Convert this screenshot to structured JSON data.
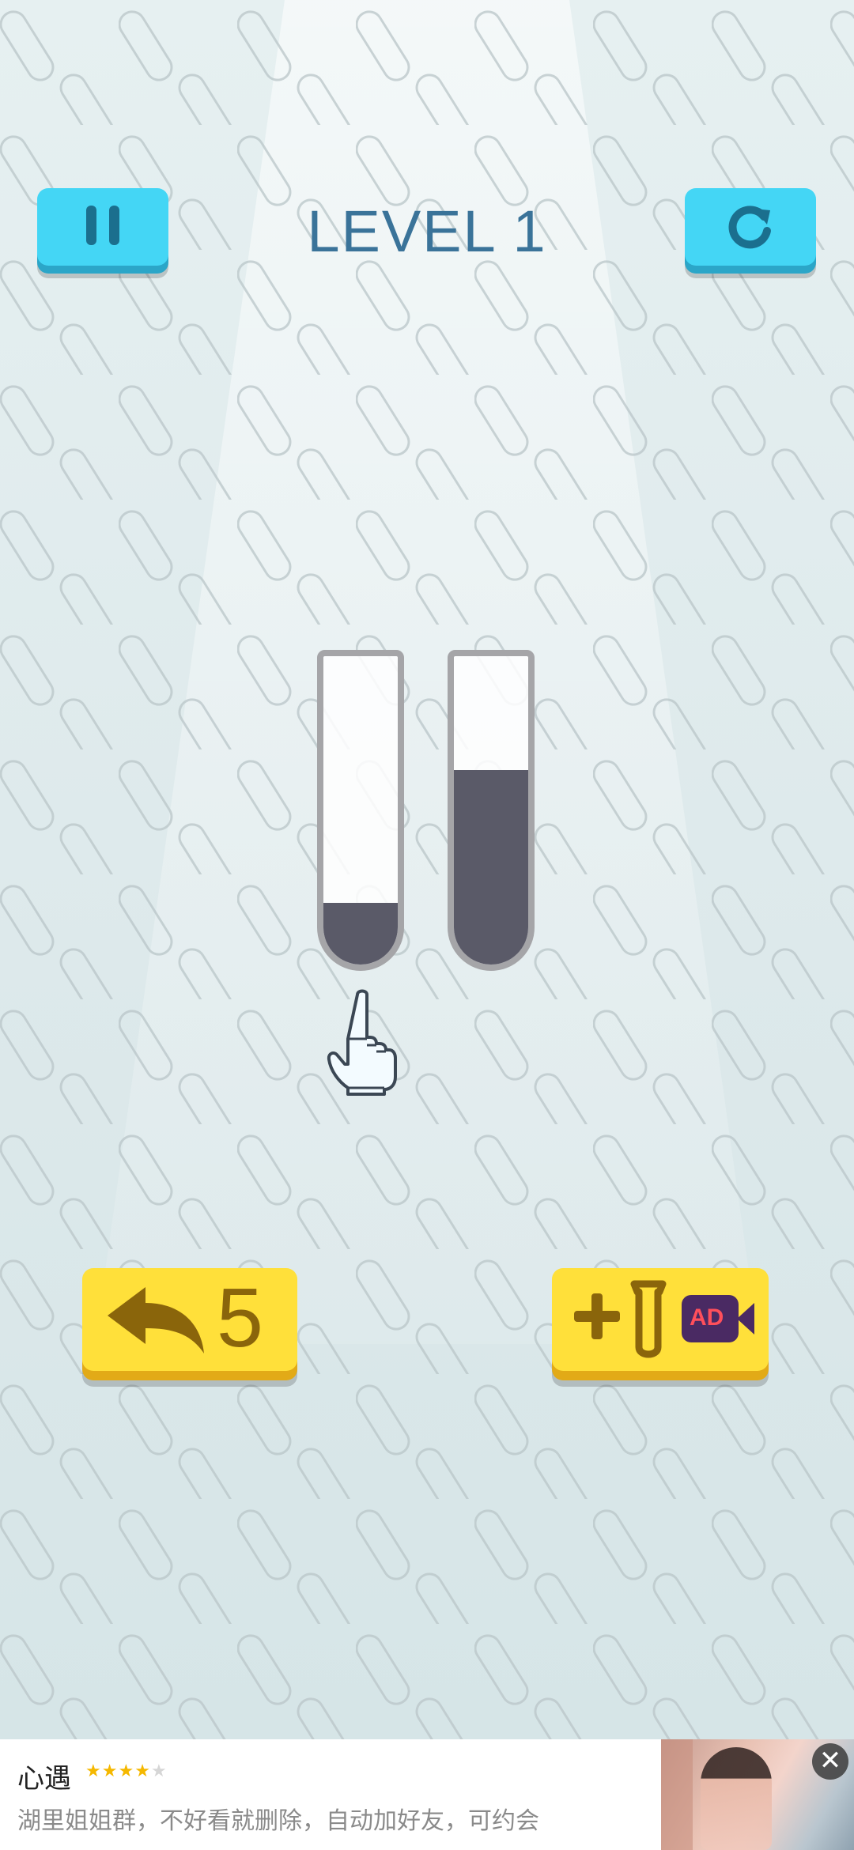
{
  "colors": {
    "button_blue": "#44d6f5",
    "button_yellow": "#ffe03a",
    "liquid": "#5a5a68",
    "title": "#3a7399"
  },
  "header": {
    "pause_icon": "pause-icon",
    "restart_icon": "restart-icon",
    "level_title": "LEVEL 1"
  },
  "tubes": [
    {
      "fill_fraction": 0.2,
      "color": "#5a5a68"
    },
    {
      "fill_fraction": 0.63,
      "color": "#5a5a68"
    }
  ],
  "hint": {
    "icon": "pointing-hand-icon"
  },
  "controls": {
    "undo_icon": "undo-arrow-icon",
    "undo_count": "5",
    "add_tube_icon": "plus-tube-icon",
    "ad_label": "AD"
  },
  "ad_banner": {
    "title": "心遇",
    "rating": 4,
    "rating_max": 5,
    "description": "湖里姐姐群，不好看就删除，自动加好友，可约会",
    "close_icon": "close-icon"
  }
}
